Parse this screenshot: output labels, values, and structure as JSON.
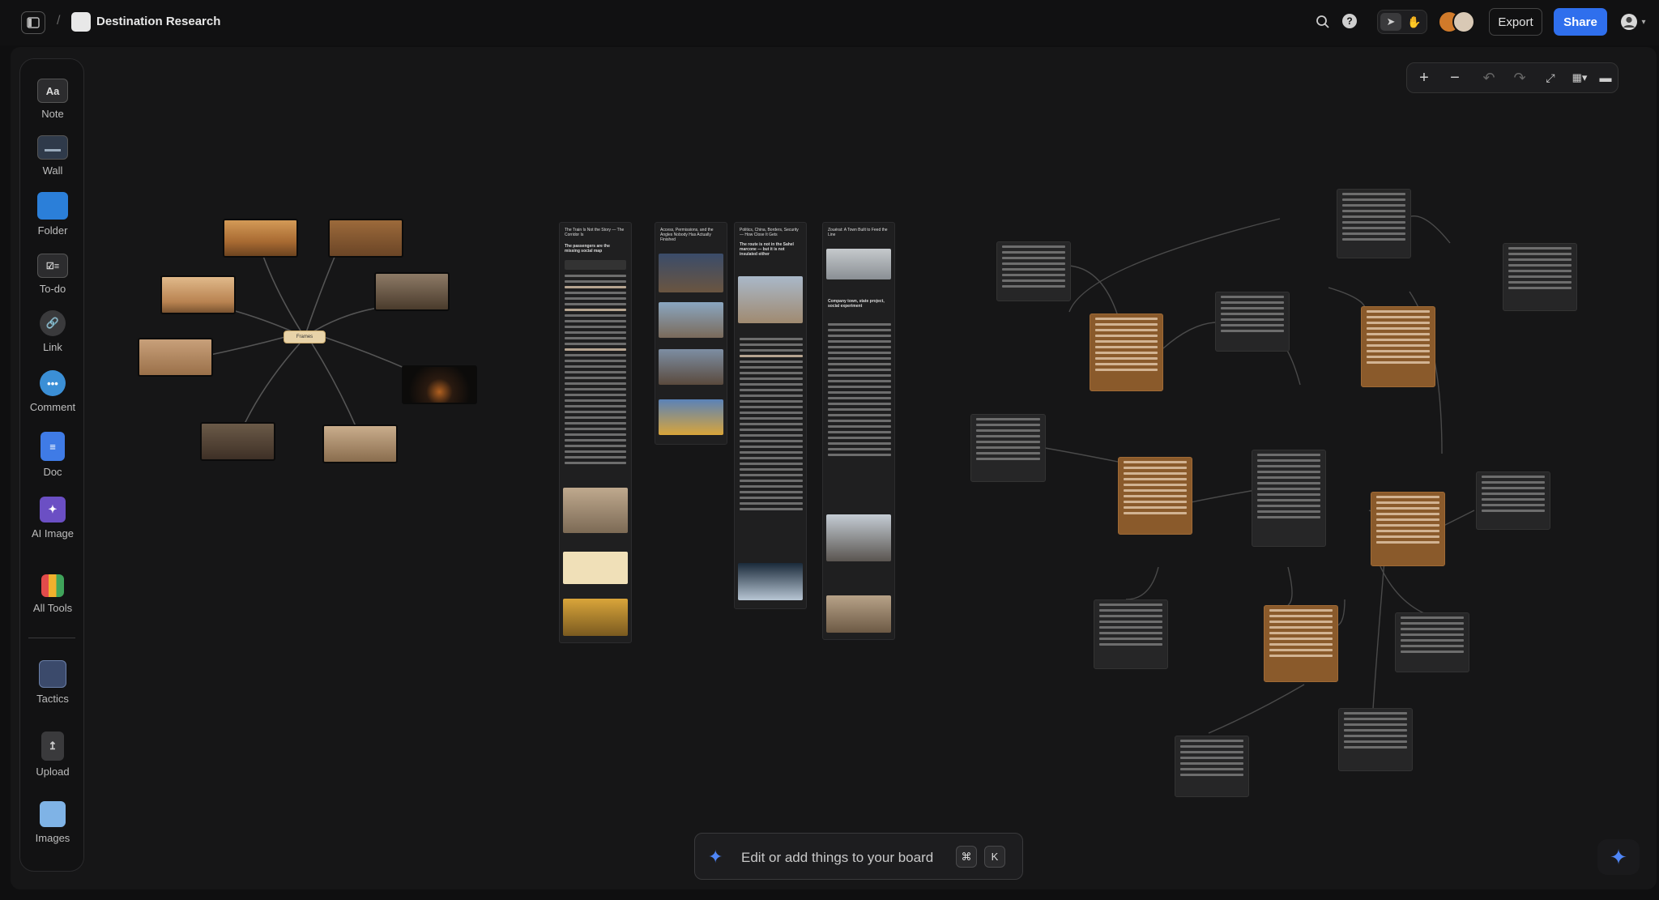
{
  "topbar": {
    "board_title": "Destination Research",
    "breadcrumb_separator": "/",
    "export_label": "Export",
    "share_label": "Share"
  },
  "sidebar": {
    "tools": [
      {
        "label": "Note",
        "icon": "note-icon",
        "glyph": "Aa"
      },
      {
        "label": "Wall",
        "icon": "wall-icon"
      },
      {
        "label": "Folder",
        "icon": "folder-icon"
      },
      {
        "label": "To-do",
        "icon": "todo-icon"
      },
      {
        "label": "Link",
        "icon": "link-icon"
      },
      {
        "label": "Comment",
        "icon": "comment-icon"
      },
      {
        "label": "Doc",
        "icon": "doc-icon"
      },
      {
        "label": "AI Image",
        "icon": "ai-image-icon"
      },
      {
        "label": "All Tools",
        "icon": "all-tools-icon"
      },
      {
        "label": "Tactics",
        "icon": "tactics-icon"
      },
      {
        "label": "Upload",
        "icon": "upload-icon"
      },
      {
        "label": "Images",
        "icon": "images-icon"
      }
    ]
  },
  "board": {
    "hub_label": "Frames",
    "columns": [
      {
        "title": "The Train Is Not the Story — The Corridor Is",
        "subtitle": "The passengers are the missing social map"
      },
      {
        "title": "Access, Permissions, and the Angles Nobody Has Actually Finished"
      },
      {
        "title": "Politics, China, Borders, Security — How Close It Gets",
        "subtitle": "The route is not in the Sahel marcone — but it is not insulated either"
      },
      {
        "title": "Zouérat: A Town Built to Feed the Line",
        "subtitle": "Company town, state project, social experiment"
      }
    ]
  },
  "command_bar": {
    "placeholder": "Edit or add things to your board",
    "key_modifier": "⌘",
    "key_letter": "K"
  },
  "colors": {
    "accent": "#2f6fed",
    "orange_card": "#8a5a2b",
    "canvas": "#161617"
  }
}
